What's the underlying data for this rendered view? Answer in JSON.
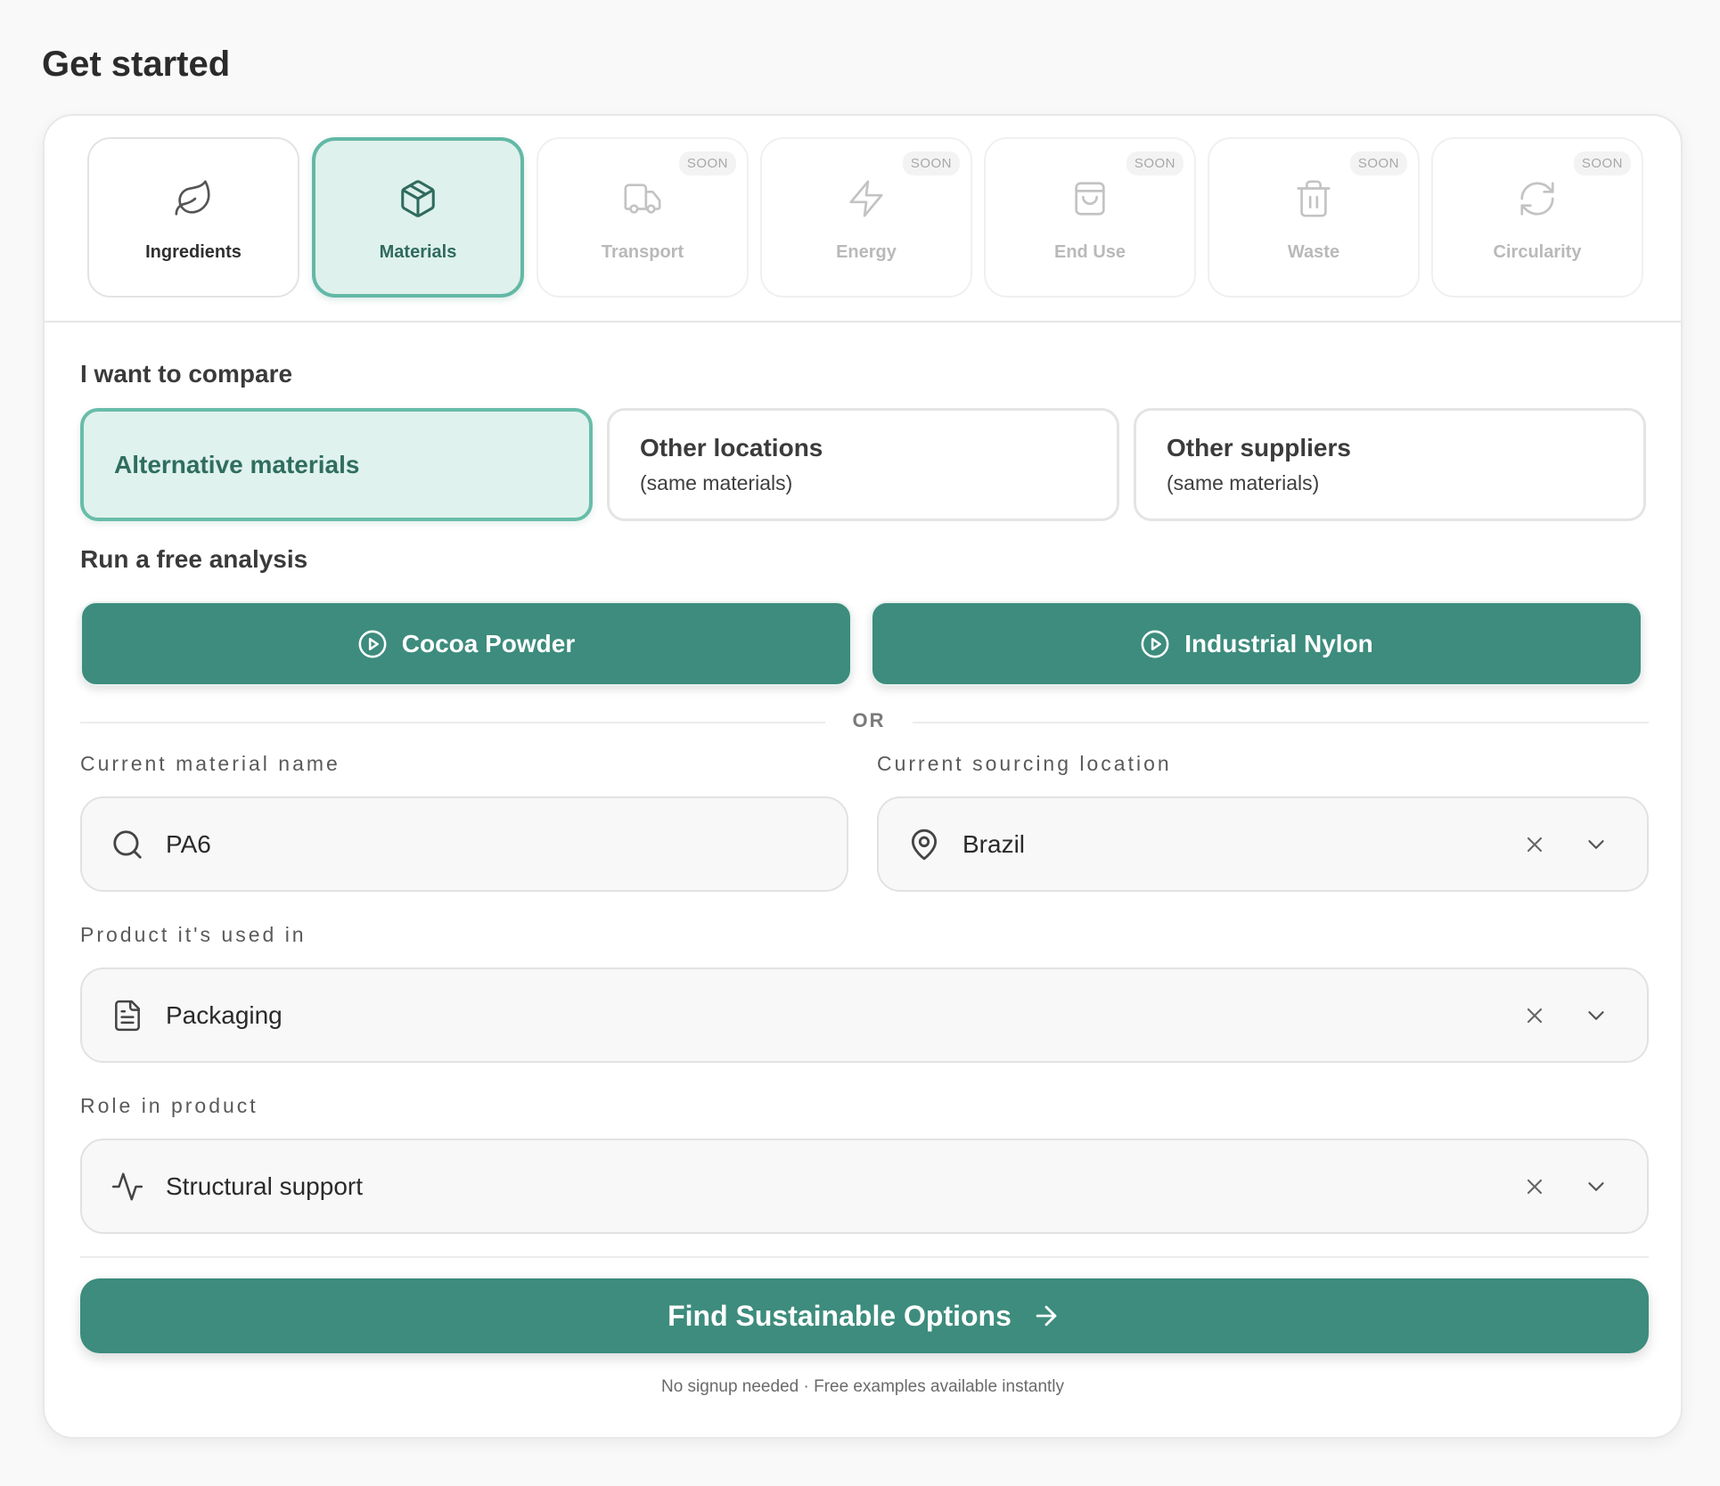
{
  "page_title": "Get started",
  "tabs": [
    {
      "label": "Ingredients",
      "icon": "leaf-icon",
      "state": "default"
    },
    {
      "label": "Materials",
      "icon": "box-icon",
      "state": "active"
    },
    {
      "label": "Transport",
      "icon": "truck-icon",
      "state": "soon",
      "badge": "SOON"
    },
    {
      "label": "Energy",
      "icon": "lightning-icon",
      "state": "soon",
      "badge": "SOON"
    },
    {
      "label": "End Use",
      "icon": "shopping-bag-icon",
      "state": "soon",
      "badge": "SOON"
    },
    {
      "label": "Waste",
      "icon": "trash-icon",
      "state": "soon",
      "badge": "SOON"
    },
    {
      "label": "Circularity",
      "icon": "refresh-icon",
      "state": "soon",
      "badge": "SOON"
    }
  ],
  "compare": {
    "heading": "I want to compare",
    "options": [
      {
        "title": "Alternative materials",
        "subtitle": "",
        "selected": true
      },
      {
        "title": "Other locations",
        "subtitle": "(same materials)",
        "selected": false
      },
      {
        "title": "Other suppliers",
        "subtitle": "(same materials)",
        "selected": false
      }
    ]
  },
  "analysis": {
    "heading": "Run a free analysis",
    "examples": [
      {
        "label": "Cocoa Powder",
        "icon": "play-circle-icon"
      },
      {
        "label": "Industrial Nylon",
        "icon": "play-circle-icon"
      }
    ],
    "divider_text": "OR"
  },
  "form": {
    "material": {
      "label": "Current material name",
      "value": "PA6",
      "icon": "search-icon"
    },
    "location": {
      "label": "Current sourcing location",
      "value": "Brazil",
      "icon": "map-pin-icon"
    },
    "product": {
      "label": "Product it's used in",
      "value": "Packaging",
      "icon": "document-icon"
    },
    "role": {
      "label": "Role in product",
      "value": "Structural support",
      "icon": "activity-icon"
    }
  },
  "cta": {
    "label": "Find Sustainable Options",
    "icon": "arrow-right-icon"
  },
  "footnote": "No signup needed · Free examples available instantly",
  "colors": {
    "accent": "#3d8c7d",
    "accent_light": "#e0f2ed",
    "accent_border": "#68bda9",
    "page_bg": "#f9f9f9"
  }
}
